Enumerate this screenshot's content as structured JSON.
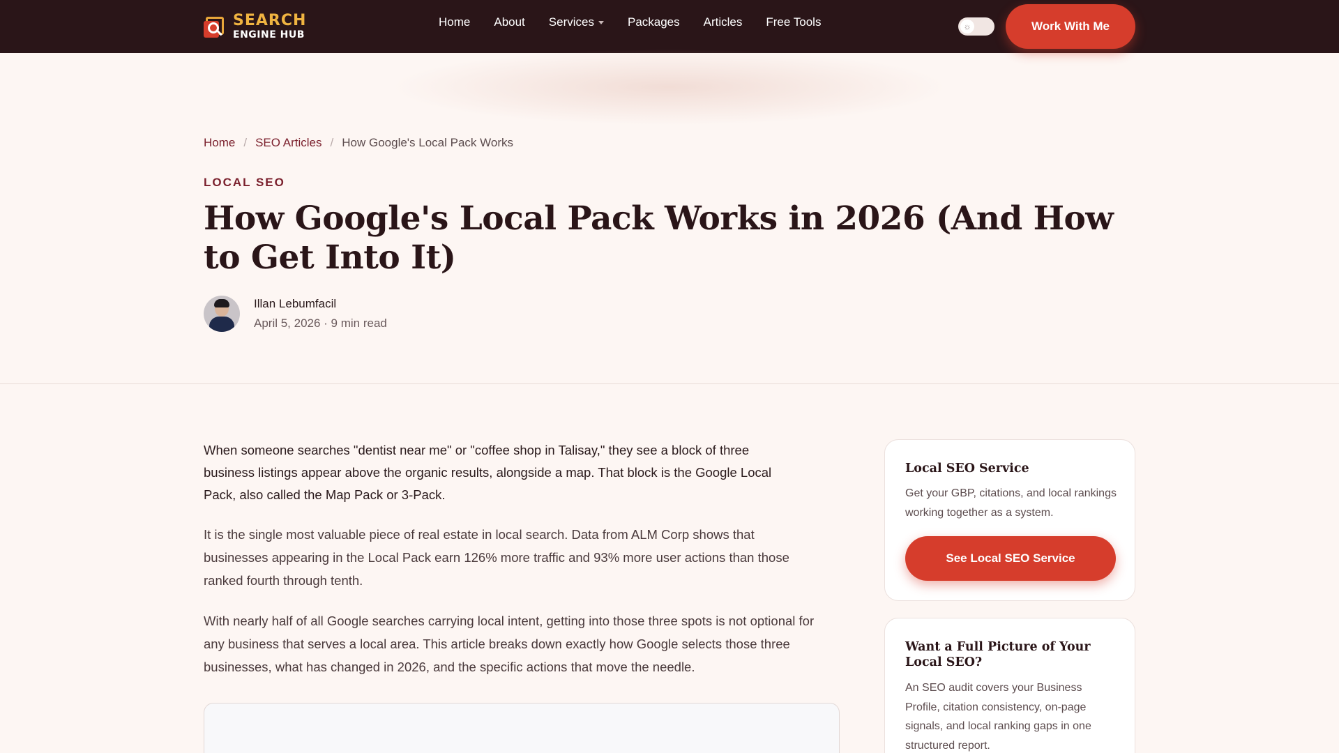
{
  "nav": {
    "logo_line1": "SEARCH",
    "logo_line2": "ENGINE HUB",
    "links": [
      "Home",
      "About",
      "Services",
      "Packages",
      "Articles",
      "Free Tools"
    ],
    "toggle_icon": "☼",
    "cta": "Work With Me"
  },
  "breadcrumb": {
    "home": "Home",
    "section": "SEO Articles",
    "current": "How Google's Local Pack Works",
    "separator": "/"
  },
  "article": {
    "category": "LOCAL SEO",
    "title": "How Google's Local Pack Works in 2026 (And How to Get Into It)",
    "author": "Illan Lebumfacil",
    "meta": "April 5, 2026 · 9 min read",
    "paragraphs": [
      "When someone searches \"dentist near me\" or \"coffee shop in Talisay,\" they see a block of three business listings appear above the organic results, alongside a map. That block is the Google Local Pack, also called the Map Pack or 3-Pack.",
      "It is the single most valuable piece of real estate in local search. Data from ALM Corp shows that businesses appearing in the Local Pack earn 126% more traffic and 93% more user actions than those ranked fourth through tenth.",
      "With nearly half of all Google searches carrying local intent, getting into those three spots is not optional for any business that serves a local area. This article breaks down exactly how Google selects those three businesses, what has changed in 2026, and the specific actions that move the needle."
    ]
  },
  "sidebar": {
    "card1": {
      "title": "Local SEO Service",
      "desc": "Get your GBP, citations, and local rankings working together as a system.",
      "cta": "See Local SEO Service"
    },
    "card2": {
      "title": "Want a Full Picture of Your Local SEO?",
      "desc": "An SEO audit covers your Business Profile, citation consistency, on-page signals, and local ranking gaps in one structured report."
    }
  },
  "colors": {
    "nav_bg": "#2a1518",
    "accent": "#d63d2c",
    "brand_maroon": "#7a1f2c",
    "page_bg": "#fdf6f3"
  }
}
